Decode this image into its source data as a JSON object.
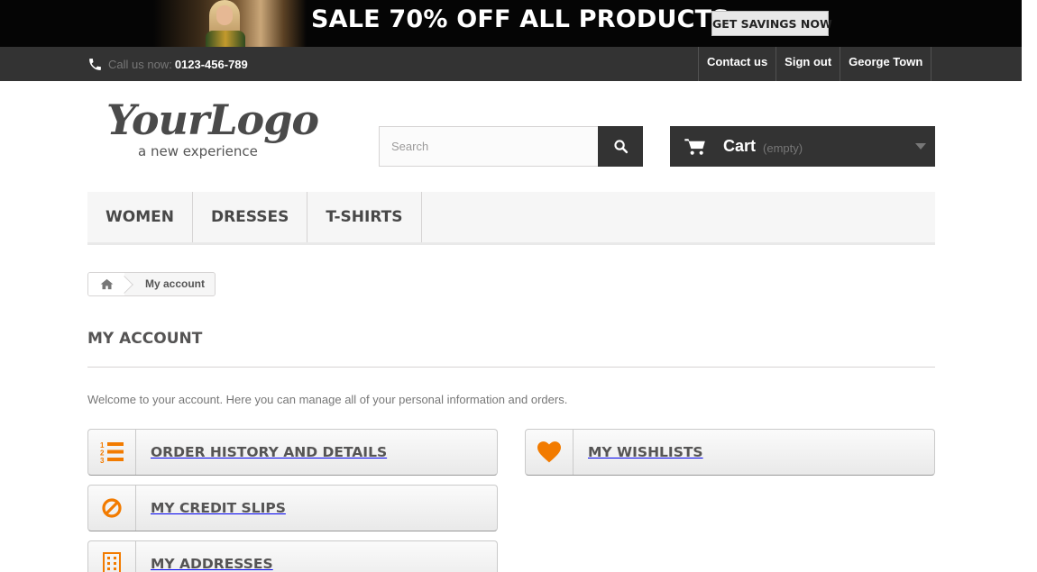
{
  "promo": {
    "headline": "SALE 70% OFF ALL PRODUCTS",
    "cta": "GET SAVINGS NOW"
  },
  "topbar": {
    "phone_label": "Call us now:",
    "phone_number": "0123-456-789",
    "links": [
      "Contact us",
      "Sign out",
      "George Town"
    ]
  },
  "header": {
    "logo_text": "YourLogo",
    "logo_tagline": "a new experience",
    "search_placeholder": "Search",
    "cart_label": "Cart",
    "cart_status": "(empty)"
  },
  "menu": {
    "items": [
      "WOMEN",
      "DRESSES",
      "T-SHIRTS"
    ]
  },
  "breadcrumb": {
    "current": "My account"
  },
  "page": {
    "title": "MY ACCOUNT",
    "welcome": "Welcome to your account. Here you can manage all of your personal information and orders."
  },
  "account_links": {
    "order_history": "ORDER HISTORY AND DETAILS",
    "wishlists": "MY WISHLISTS",
    "credit_slips": "MY CREDIT SLIPS",
    "addresses": "MY ADDRESSES"
  },
  "colors": {
    "accent": "#f27b00",
    "dark_bar": "#333333"
  },
  "icons": {
    "phone": "phone-icon",
    "search": "search-icon",
    "cart": "cart-icon",
    "home": "home-icon",
    "order_history": "numbered-list-icon",
    "wishlists": "heart-icon",
    "credit_slips": "ban-icon",
    "addresses": "building-icon"
  }
}
